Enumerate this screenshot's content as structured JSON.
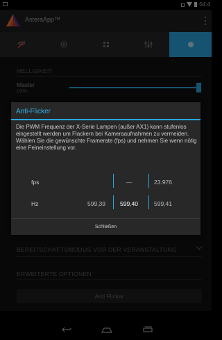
{
  "status_bar": {
    "time": "04:4"
  },
  "app_bar": {
    "title": "AsteraApp™"
  },
  "tabs": [
    {
      "icon": "antenna-off-icon",
      "active": false
    },
    {
      "icon": "target-icon",
      "active": false
    },
    {
      "icon": "grid-icon",
      "active": false
    },
    {
      "icon": "equalizer-icon",
      "active": false
    },
    {
      "icon": "settings-dot-icon",
      "active": true
    }
  ],
  "content": {
    "brightness_header": "HELLIGKEIT",
    "master_label": "Master",
    "master_value": "100%",
    "master_level_fraction": 1.0,
    "standby_header": "BEREITSCHAFTSMODUS VOR DER VERANSTALTUNG",
    "advanced_header": "ERWEITERTE OPTIONEN",
    "anti_flicker_button": "Anti Flicker"
  },
  "dialog": {
    "title": "Anti-Flicker",
    "message": "Die PWM Frequenz der X-Serie Lampen (außer AX1) kann stufenlos eingestellt werden um Flackern bei Kameraaufnahmen zu vermeiden. Wählen Sie die gewünschte Framerate (fps) und nehmen Sie wenn nötig eine Feineinstellung vor.",
    "fps_label": "fps",
    "fps_values": [
      "",
      "—",
      "23.976"
    ],
    "hz_label": "Hz",
    "hz_values": [
      "599,39",
      "599,40",
      "599,41"
    ],
    "close_label": "Schließen"
  },
  "colors": {
    "accent": "#2aa7e0",
    "logo_orange": "#f07a2a",
    "logo_purple": "#5a2d82"
  }
}
